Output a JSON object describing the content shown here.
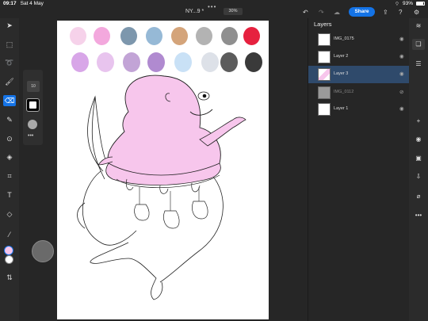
{
  "status": {
    "time": "09:17",
    "date": "Sat 4 May",
    "battery": "93%"
  },
  "topbar": {
    "title": "NY...9 *",
    "zoom": "30%",
    "share_label": "Share"
  },
  "left_tools": [
    {
      "name": "select-tool-icon",
      "glyph": "➤"
    },
    {
      "name": "transform-tool-icon",
      "glyph": "⬚"
    },
    {
      "name": "lasso-tool-icon",
      "glyph": "➰"
    },
    {
      "name": "brush-tool-icon",
      "glyph": "🖌"
    },
    {
      "name": "eraser-tool-icon",
      "glyph": "⌫"
    },
    {
      "name": "smudge-tool-icon",
      "glyph": "✎"
    },
    {
      "name": "clone-tool-icon",
      "glyph": "⊙"
    },
    {
      "name": "fill-tool-icon",
      "glyph": "◈"
    },
    {
      "name": "crop-tool-icon",
      "glyph": "⌗"
    },
    {
      "name": "text-tool-icon",
      "glyph": "T"
    },
    {
      "name": "shape-tool-icon",
      "glyph": "◇"
    },
    {
      "name": "eyedropper-tool-icon",
      "glyph": "⁄"
    }
  ],
  "brush_panel": {
    "size_value": "10",
    "more": "•••"
  },
  "palette_row1": [
    "#f6d2ea",
    "#f3a8dd",
    "#7d97ad",
    "#96b9d6",
    "#d4a47a",
    "#b3b3b3",
    "#8f8f8f",
    "#e6213f"
  ],
  "palette_row2": [
    "#d8a6e8",
    "#e8c4ee",
    "#c2a4d6",
    "#b08ad0",
    "#c9e1f6",
    "#dde1e8",
    "#5c5c5c",
    "#3a3a3a"
  ],
  "layers": {
    "header": "Layers",
    "items": [
      {
        "name": "IMG_0175",
        "selected": false,
        "dim": false,
        "hidden": false
      },
      {
        "name": "Layer 2",
        "selected": false,
        "dim": false,
        "hidden": false
      },
      {
        "name": "Layer 3",
        "selected": true,
        "dim": false,
        "hidden": false
      },
      {
        "name": "IMG_0112",
        "selected": false,
        "dim": true,
        "hidden": true
      },
      {
        "name": "Layer 1",
        "selected": false,
        "dim": false,
        "hidden": false
      }
    ]
  },
  "right_tools": [
    {
      "name": "layers-stack-icon",
      "glyph": "≋"
    },
    {
      "name": "layer-properties-icon",
      "glyph": "❏"
    },
    {
      "name": "adjustments-icon",
      "glyph": "☰"
    },
    {
      "name": "add-layer-icon",
      "glyph": "+"
    },
    {
      "name": "visibility-icon",
      "glyph": "◉"
    },
    {
      "name": "mask-icon",
      "glyph": "▣"
    },
    {
      "name": "merge-icon",
      "glyph": "⇩"
    },
    {
      "name": "clear-icon",
      "glyph": "⌀"
    },
    {
      "name": "more-options-icon",
      "glyph": "•••"
    }
  ],
  "colors": {
    "accent": "#1473e6",
    "creature_pink": "#f7c6ec"
  }
}
